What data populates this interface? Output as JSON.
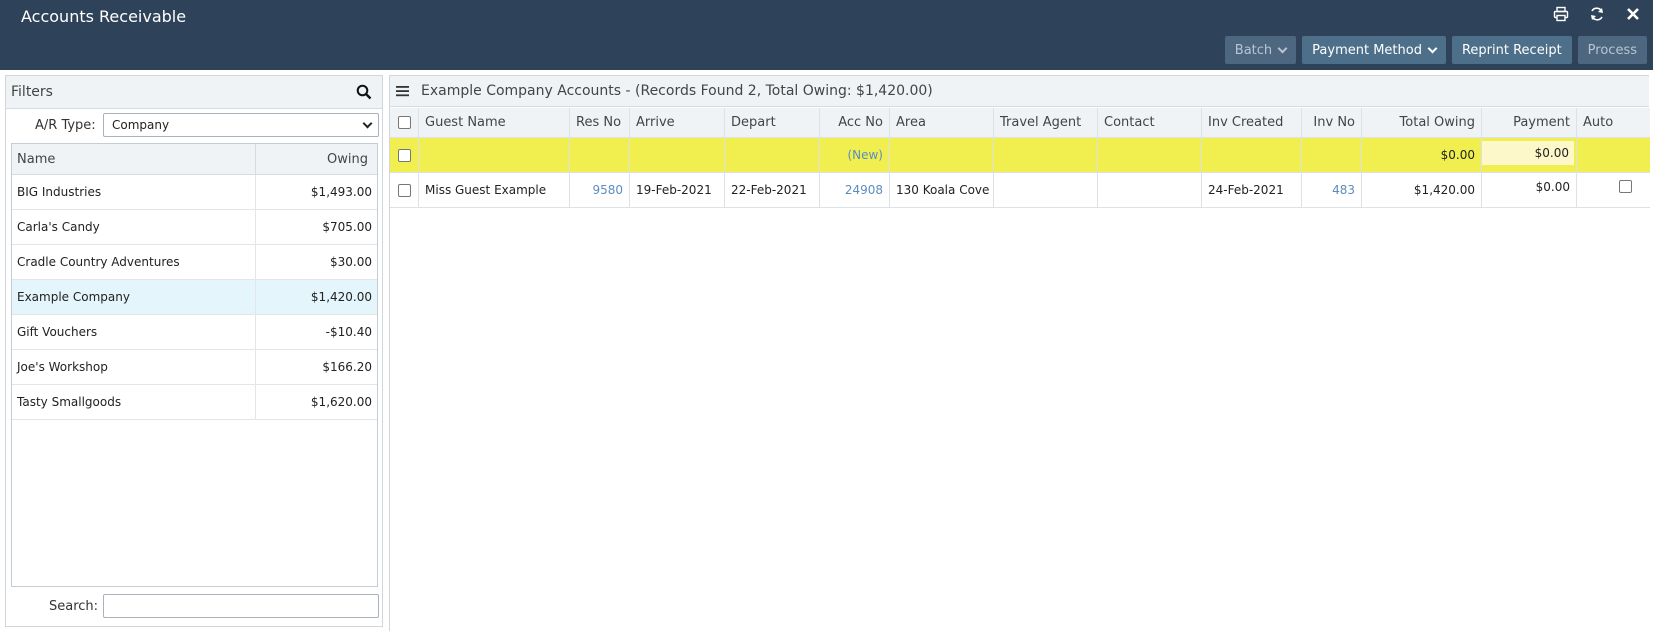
{
  "app": {
    "title": "Accounts Receivable"
  },
  "window_icons": [
    "print-icon",
    "refresh-icon",
    "close-icon"
  ],
  "toolbar": {
    "batch_label": "Batch",
    "payment_method_label": "Payment Method",
    "reprint_label": "Reprint Receipt",
    "process_label": "Process"
  },
  "filters": {
    "title": "Filters",
    "ar_type_label": "A/R Type:",
    "ar_type_value": "Company",
    "columns": {
      "name": "Name",
      "owing": "Owing"
    },
    "companies": [
      {
        "name": "BIG Industries",
        "owing": "$1,493.00"
      },
      {
        "name": "Carla's Candy",
        "owing": "$705.00"
      },
      {
        "name": "Cradle Country Adventures",
        "owing": "$30.00"
      },
      {
        "name": "Example Company",
        "owing": "$1,420.00"
      },
      {
        "name": "Gift Vouchers",
        "owing": "-$10.40"
      },
      {
        "name": "Joe's Workshop",
        "owing": "$166.20"
      },
      {
        "name": "Tasty Smallgoods",
        "owing": "$1,620.00"
      }
    ],
    "search_label": "Search:",
    "search_value": ""
  },
  "accounts": {
    "title": "Example Company Accounts - (Records Found 2, Total Owing: $1,420.00)",
    "columns": {
      "guest_name": "Guest Name",
      "res_no": "Res No",
      "arrive": "Arrive",
      "depart": "Depart",
      "acc_no": "Acc No",
      "area": "Area",
      "travel_agent": "Travel Agent",
      "contact": "Contact",
      "inv_created": "Inv Created",
      "inv_no": "Inv No",
      "total_owing": "Total Owing",
      "payment": "Payment",
      "auto": "Auto"
    },
    "new_row": {
      "acc_no": "(New)",
      "total_owing": "$0.00",
      "payment": "$0.00"
    },
    "rows": [
      {
        "guest_name": "Miss Guest Example",
        "res_no": "9580",
        "arrive": "19-Feb-2021",
        "depart": "22-Feb-2021",
        "acc_no": "24908",
        "area": "130 Koala Cove",
        "travel_agent": "",
        "contact": "",
        "inv_created": "24-Feb-2021",
        "inv_no": "483",
        "total_owing": "$1,420.00",
        "payment": "$0.00"
      }
    ]
  },
  "colors": {
    "header_bg": "#2e4359",
    "button_bg": "#4d6f8a",
    "new_row_bg": "#f0ef4f",
    "selected_row_bg": "#e4f6fb",
    "link": "#5b8dbf"
  }
}
